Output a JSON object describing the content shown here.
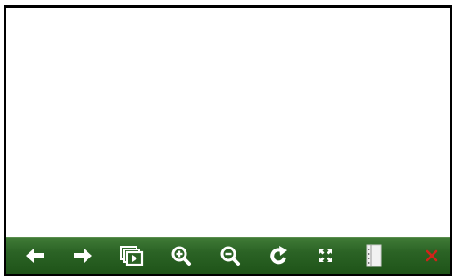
{
  "viewer": {
    "background_color": "#ffffff"
  },
  "toolbar": {
    "background_color": "#2b6325",
    "icon_color": "#ffffff",
    "close_icon_color": "#d1231a",
    "buttons": [
      {
        "name": "previous-button",
        "icon": "arrow-left-icon"
      },
      {
        "name": "next-button",
        "icon": "arrow-right-icon"
      },
      {
        "name": "slideshow-button",
        "icon": "slideshow-icon"
      },
      {
        "name": "zoom-in-button",
        "icon": "zoom-in-icon"
      },
      {
        "name": "zoom-out-button",
        "icon": "zoom-out-icon"
      },
      {
        "name": "rotate-button",
        "icon": "rotate-icon"
      },
      {
        "name": "fit-screen-button",
        "icon": "fit-screen-icon"
      },
      {
        "name": "details-button",
        "icon": "document-icon"
      },
      {
        "name": "close-button",
        "icon": "close-icon"
      }
    ]
  }
}
